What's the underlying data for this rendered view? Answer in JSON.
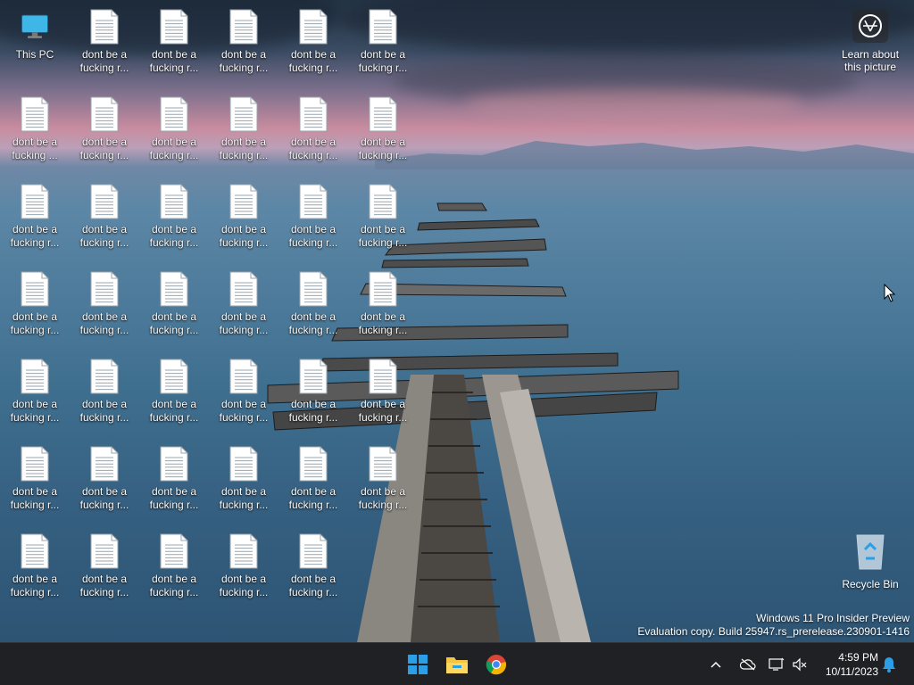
{
  "desktop": {
    "this_pc_label": "This PC",
    "file_label_full": "dont be a\nfucking r...",
    "file_label_short": "dont be a\nfucking ...",
    "learn_label": "Learn about\nthis picture",
    "recycle_label": "Recycle Bin",
    "watermark_line1": "Windows 11 Pro Insider Preview",
    "watermark_line2": "Evaluation copy. Build 25947.rs_prerelease.230901-1416"
  },
  "taskbar": {
    "time": "4:59 PM",
    "date": "10/11/2023",
    "icons": [
      "start-icon",
      "file-explorer-icon",
      "chrome-icon",
      "chevron-up-icon",
      "cloud-off-icon",
      "network-icon",
      "volume-muted-icon",
      "bell-icon"
    ]
  },
  "colors": {
    "taskbar_bg": "#1f2124",
    "windows_blue": "#2a9fe8",
    "folder_yellow": "#f4c443"
  }
}
